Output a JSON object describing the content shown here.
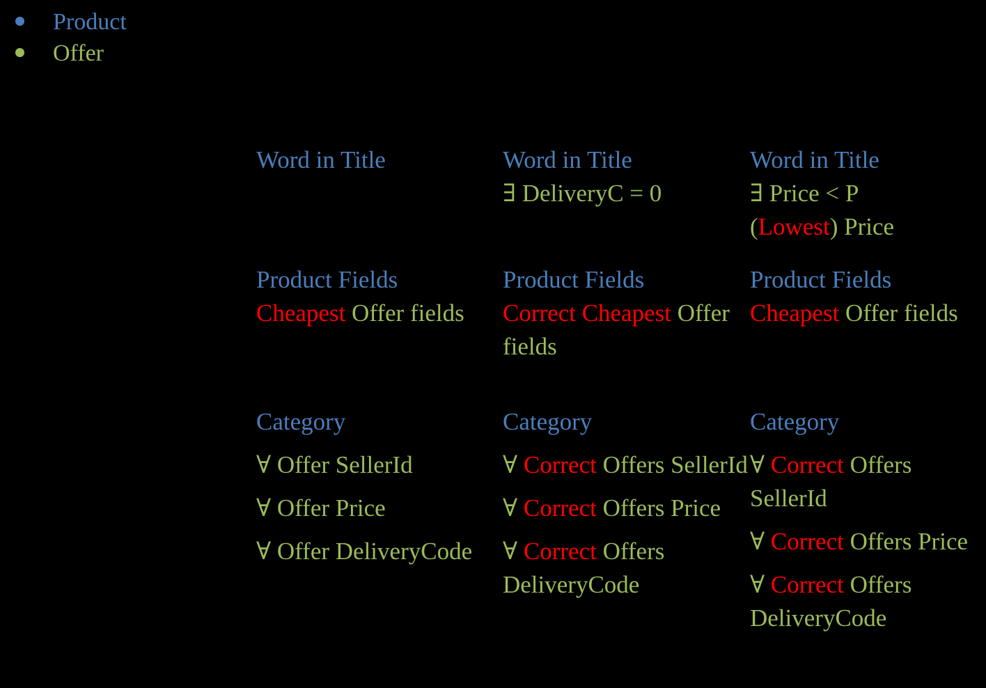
{
  "colors": {
    "background": "#000000",
    "blue": "#4A7EBB",
    "green": "#9BBB59",
    "red": "#FF0000"
  },
  "bullets": [
    {
      "label": "Product",
      "color": "blue",
      "bullet_icon": "bullet-dot-icon"
    },
    {
      "label": "Offer",
      "color": "green",
      "bullet_icon": "bullet-dot-icon"
    }
  ],
  "columns": [
    {
      "header": {
        "title": "Word in Title",
        "condition_prefix": "",
        "condition": "",
        "extra_prefix": "",
        "extra_highlight": "",
        "extra_suffix": ""
      },
      "fields": {
        "title": "Product Fields",
        "highlight": "Cheapest",
        "rest": " Offer fields"
      },
      "category": {
        "title": "Category",
        "items": [
          {
            "quantifier": "∀ ",
            "highlight": "",
            "rest": "Offer SellerId"
          },
          {
            "quantifier": "∀ ",
            "highlight": "",
            "rest": "Offer Price"
          },
          {
            "quantifier": "∀ ",
            "highlight": "",
            "rest": "Offer DeliveryCode"
          }
        ]
      }
    },
    {
      "header": {
        "title": "Word in Title",
        "condition_prefix": "∃ ",
        "condition": "DeliveryC = 0",
        "extra_prefix": "",
        "extra_highlight": "",
        "extra_suffix": ""
      },
      "fields": {
        "title": "Product Fields",
        "highlight": "Correct Cheapest",
        "rest": " Offer fields"
      },
      "category": {
        "title": "Category",
        "items": [
          {
            "quantifier": "∀ ",
            "highlight": "Correct",
            "rest": " Offers SellerId"
          },
          {
            "quantifier": "∀ ",
            "highlight": "Correct",
            "rest": " Offers Price"
          },
          {
            "quantifier": "∀ ",
            "highlight": "Correct",
            "rest": " Offers DeliveryCode"
          }
        ]
      }
    },
    {
      "header": {
        "title": "Word in Title",
        "condition_prefix": "∃ ",
        "condition": "Price < P",
        "extra_prefix": "(",
        "extra_highlight": "Lowest",
        "extra_suffix": ") Price"
      },
      "fields": {
        "title": "Product Fields",
        "highlight": "Cheapest",
        "rest": " Offer fields"
      },
      "category": {
        "title": "Category",
        "items": [
          {
            "quantifier": "∀ ",
            "highlight": "Correct",
            "rest": " Offers SellerId"
          },
          {
            "quantifier": "∀ ",
            "highlight": "Correct",
            "rest": " Offers Price"
          },
          {
            "quantifier": "∀ ",
            "highlight": "Correct",
            "rest": " Offers DeliveryCode"
          }
        ]
      }
    }
  ]
}
